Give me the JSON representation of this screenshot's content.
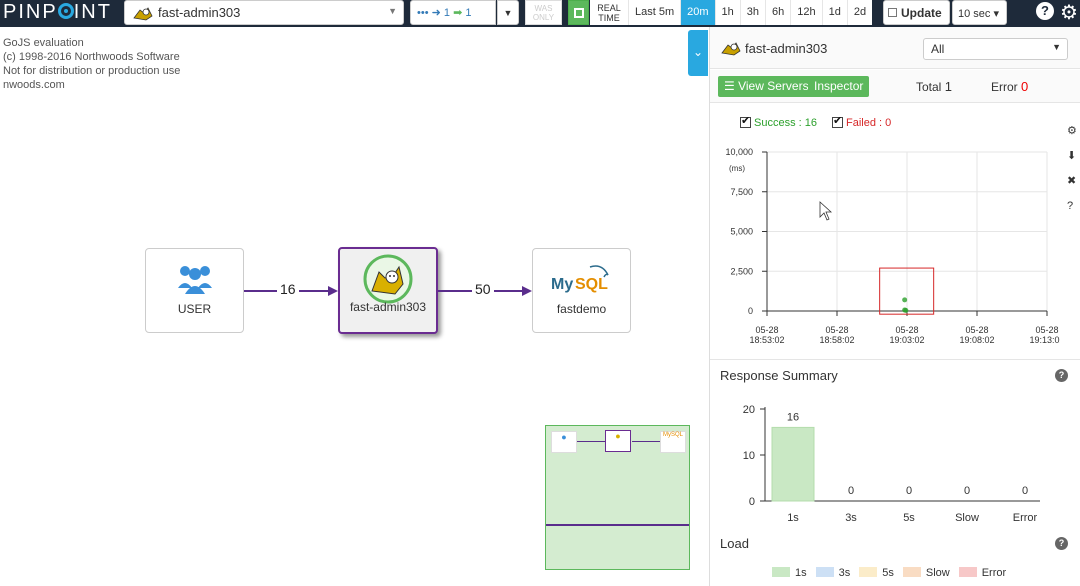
{
  "topbar": {
    "logo": "PINPOINT",
    "app_name": "fast-admin303",
    "depth_in": "1",
    "depth_out": "1",
    "was_only": "WAS ONLY",
    "real_time": "REAL TIME",
    "ranges": [
      "Last 5m",
      "20m",
      "1h",
      "3h",
      "6h",
      "12h",
      "1d",
      "2d"
    ],
    "active_range": "20m",
    "update_label": "Update",
    "interval": "10 sec"
  },
  "watermark": [
    "GoJS evaluation",
    "(c) 1998-2016 Northwoods Software",
    "Not for distribution or production use",
    "nwoods.com"
  ],
  "servermap": {
    "nodes": [
      {
        "label": "USER"
      },
      {
        "label": "fast-admin303"
      },
      {
        "label": "fastdemo",
        "logo": "MySQL"
      }
    ],
    "edges": [
      "16",
      "50"
    ]
  },
  "panel": {
    "app_name": "fast-admin303",
    "agent_filter": "All",
    "view_servers": "View Servers",
    "inspector": "Inspector",
    "total_label": "Total",
    "total_value": "1",
    "error_label": "Error",
    "error_value": "0",
    "success_label": "Success : 16",
    "failed_label": "Failed : 0",
    "response_summary_title": "Response Summary",
    "load_title": "Load",
    "load_legend": [
      "1s",
      "3s",
      "5s",
      "Slow",
      "Error"
    ],
    "colors": {
      "success": "#2ca02c",
      "failed": "#d62728",
      "accent": "#29a8e0"
    }
  },
  "chart_data": [
    {
      "type": "scatter",
      "ylabel": "(ms)",
      "ylim": [
        0,
        10000
      ],
      "y_ticks": [
        "10,000",
        "7,500",
        "5,000",
        "2,500",
        "0"
      ],
      "x_ticks": [
        "05-28 18:53:02",
        "05-28 18:58:02",
        "05-28 19:03:02",
        "05-28 19:08:02",
        "05-28 19:13:02"
      ],
      "series": [
        {
          "name": "Success",
          "points": [
            {
              "x": "05-28 19:02:52",
              "y": 700
            },
            {
              "x": "05-28 19:02:52",
              "y": 60
            },
            {
              "x": "05-28 19:02:57",
              "y": 40
            }
          ]
        },
        {
          "name": "Failed",
          "points": []
        }
      ]
    },
    {
      "type": "bar",
      "title": "Response Summary",
      "categories": [
        "1s",
        "3s",
        "5s",
        "Slow",
        "Error"
      ],
      "values": [
        16,
        0,
        0,
        0,
        0
      ],
      "ylim": [
        0,
        20
      ],
      "y_ticks": [
        "20",
        "10",
        "0"
      ]
    }
  ]
}
